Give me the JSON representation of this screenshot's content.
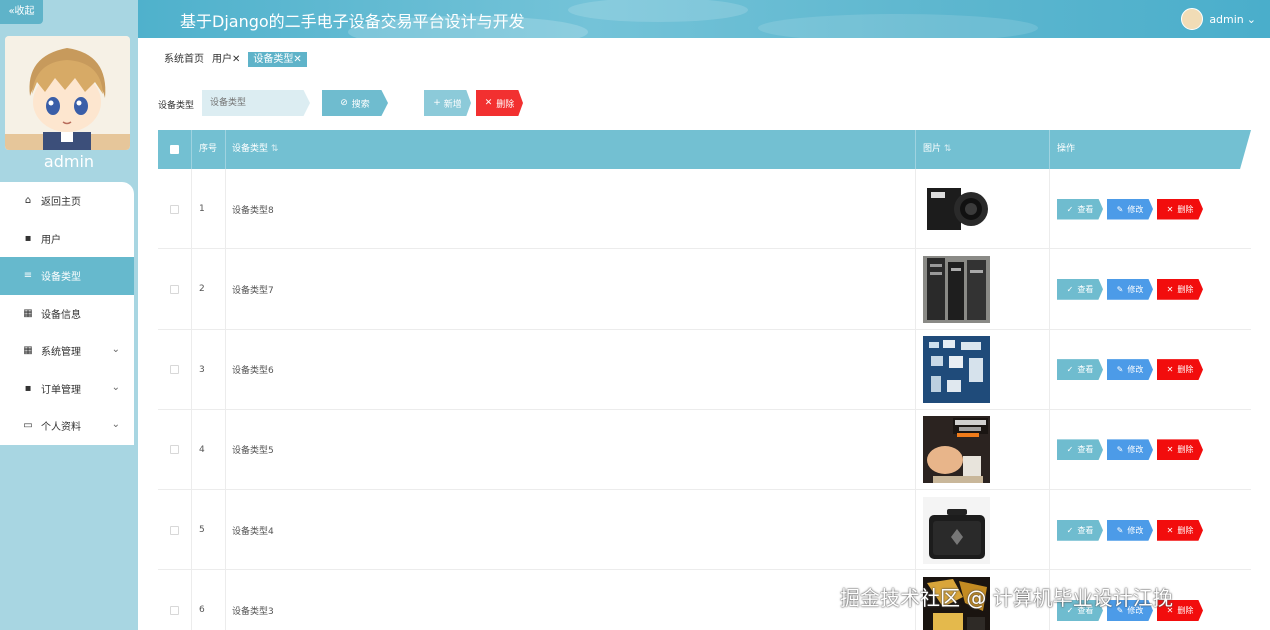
{
  "sidebar": {
    "collapse_label": "«收起",
    "user_name": "admin",
    "items": [
      {
        "label": "返回主页",
        "icon": "home-icon",
        "glyph": "⌂",
        "active": false,
        "has_submenu": false
      },
      {
        "label": "用户",
        "icon": "user-icon",
        "glyph": "▪",
        "active": false,
        "has_submenu": false
      },
      {
        "label": "设备类型",
        "icon": "list-icon",
        "glyph": "≡",
        "active": true,
        "has_submenu": false
      },
      {
        "label": "设备信息",
        "icon": "grid-icon",
        "glyph": "▦",
        "active": false,
        "has_submenu": false
      },
      {
        "label": "系统管理",
        "icon": "grid-icon",
        "glyph": "▦",
        "active": false,
        "has_submenu": true
      },
      {
        "label": "订单管理",
        "icon": "monitor-icon",
        "glyph": "▪",
        "active": false,
        "has_submenu": true
      },
      {
        "label": "个人资料",
        "icon": "id-card-icon",
        "glyph": "▭",
        "active": false,
        "has_submenu": true
      }
    ]
  },
  "header": {
    "title": "基于Django的二手电子设备交易平台设计与开发",
    "user_name": "admin",
    "dropdown_glyph": "⌄"
  },
  "tabs": [
    {
      "label": "系统首页",
      "active": false,
      "closable": false
    },
    {
      "label": "用户",
      "active": false,
      "closable": true
    },
    {
      "label": "设备类型",
      "active": true,
      "closable": true
    }
  ],
  "search": {
    "label": "设备类型",
    "placeholder": "设备类型",
    "search_button": "搜索",
    "add_button": "新增",
    "delete_button": "删除"
  },
  "table": {
    "columns": [
      "序号",
      "设备类型",
      "图片",
      "操作"
    ],
    "rows": [
      {
        "index": "1",
        "name": "设备类型8",
        "image": "camera-photo"
      },
      {
        "index": "2",
        "name": "设备类型7",
        "image": "server-rack-photo"
      },
      {
        "index": "3",
        "name": "设备类型6",
        "image": "electronics-collection-photo"
      },
      {
        "index": "4",
        "name": "设备类型5",
        "image": "rgb-light-photo"
      },
      {
        "index": "5",
        "name": "设备类型4",
        "image": "hard-case-photo"
      },
      {
        "index": "6",
        "name": "设备类型3",
        "image": "gold-device-photo"
      }
    ],
    "actions": {
      "view": "查看",
      "edit": "修改",
      "delete": "删除"
    }
  },
  "watermark": "掘金技术社区 @ 计算机毕业设计江挽",
  "colors": {
    "accent": "#5fb3c9",
    "danger": "#f20d0d",
    "edit": "#4c9be8",
    "sidebar_bg": "#a8d6e2"
  }
}
